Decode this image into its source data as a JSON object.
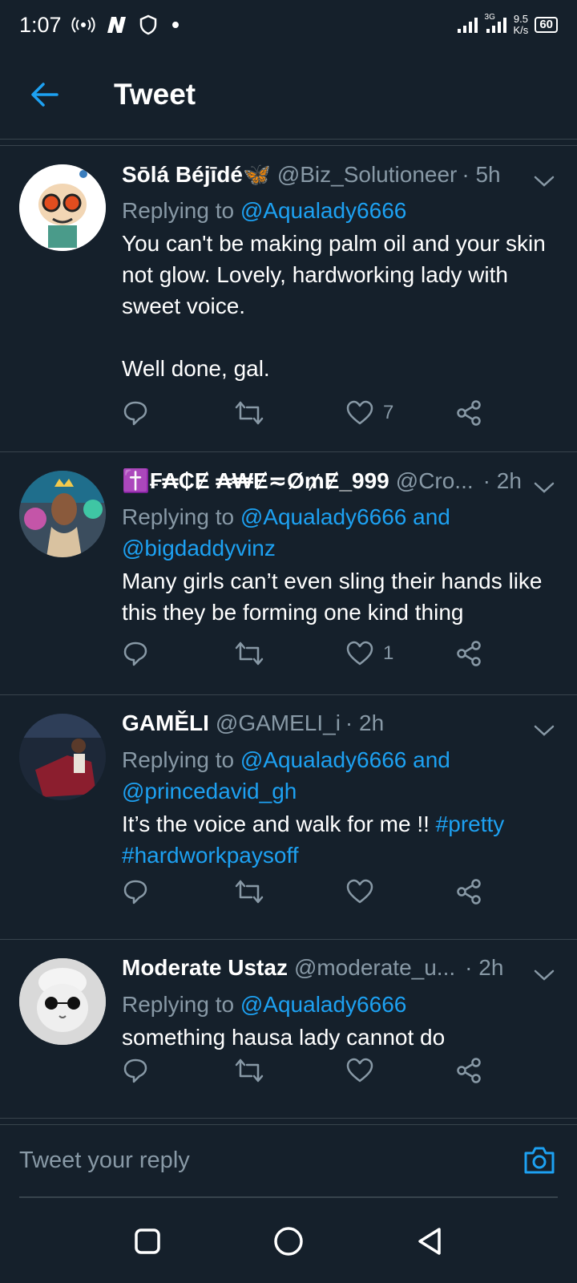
{
  "status_bar": {
    "time": "1:07",
    "network_type": "3G",
    "net_speed_value": "9.5",
    "net_speed_unit": "K/s",
    "battery": "60"
  },
  "header": {
    "title": "Tweet"
  },
  "tweets": [
    {
      "name": "Sōlá Béjīdé🦋",
      "handle": "@Biz_Solutioneer",
      "time": "· 5h",
      "replying_prefix": "Replying to ",
      "replying_to": "@Aqualady6666",
      "text": "You can't be making palm oil and your skin not glow. Lovely, hardworking lady with sweet voice.\n\nWell done, gal.",
      "likes": "7"
    },
    {
      "name": "✝️₣₳₵Ɇ ₳₩Ɇ≂Ø₥Ɇ_999",
      "handle": "@Cro...",
      "time": "· 2h",
      "replying_prefix": "Replying to ",
      "replying_to": "@Aqualady6666 and @bigdaddyvinz",
      "text": "Many girls can’t even sling their hands like this they be forming one kind thing",
      "likes": "1"
    },
    {
      "name": "GAMĚLI",
      "handle": "@GAMELI_i",
      "time": "· 2h",
      "replying_prefix": "Replying to ",
      "replying_to": "@Aqualady6666 and @princedavid_gh",
      "text_plain": "It’s the voice and walk for me !! ",
      "hashtag_1": "#pretty",
      "hashtag_2": "#hardworkpaysoff",
      "likes": ""
    },
    {
      "name": "Moderate Ustaz",
      "handle": "@moderate_u...",
      "time": "· 2h",
      "replying_prefix": "Replying to ",
      "replying_to": "@Aqualady6666",
      "text": "something hausa lady cannot do",
      "likes": ""
    }
  ],
  "reply_bar": {
    "placeholder": "Tweet your reply"
  },
  "colors": {
    "background": "#15202b",
    "accent": "#1da1f2",
    "muted": "#8899a6",
    "divider": "#38444d"
  }
}
